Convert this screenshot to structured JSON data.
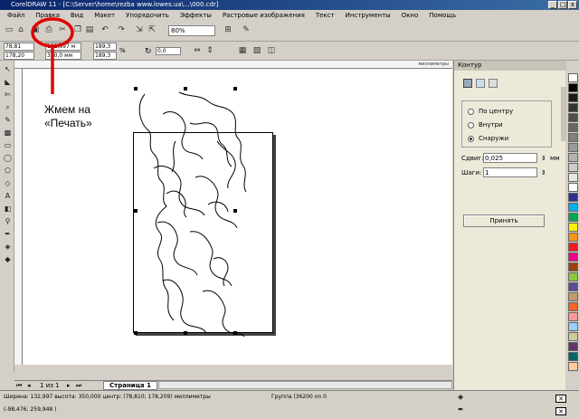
{
  "window": {
    "title": "CorelDRAW 11 - [C:\\Server\\home\\rezba www.lowes.ua\\...\\000.cdr]",
    "controls": [
      "_",
      "□",
      "x"
    ]
  },
  "menu": {
    "items": [
      "Файл",
      "Правка",
      "Вид",
      "Макет",
      "Упорядочить",
      "Эффекты",
      "Растровые изображения",
      "Текст",
      "Инструменты",
      "Окно",
      "Помощь"
    ]
  },
  "toolbar": {
    "zoom_value": "80%"
  },
  "propbar": {
    "x_value": "78,81",
    "y_value": "178,20",
    "width_value": "132,997 м",
    "height_value": "350,0 мм",
    "scale_w": "189,3",
    "scale_h": "189,3",
    "angle_value": "0,0",
    "lock_sign": "%"
  },
  "ruler": {
    "units_label": "миллиметры"
  },
  "annotation": {
    "text_line1": "Жмем на",
    "text_line2": "«Печать»"
  },
  "docker": {
    "title": "Контур",
    "options": [
      "По центру",
      "Внутри",
      "Снаружи"
    ],
    "selected_option": "Снаружи",
    "offset_label": "Сдвиг:",
    "offset_value": "0,025",
    "offset_unit": "мм",
    "steps_label": "Шаги:",
    "steps_value": "1",
    "apply_button": "Принять"
  },
  "pages": {
    "counter": "1 из 1",
    "tab_label": "Страница 1"
  },
  "status": {
    "line1": "Ширина: 132,997  высота: 350,000  центр: (78,810; 178,209)  миллиметры",
    "group_info": "Группа (36200 on 0",
    "line2": "(-98,476; 259,948 )"
  },
  "palette_colors": [
    "#ffffff",
    "#000000",
    "#1a1a1a",
    "#333333",
    "#4d4d4d",
    "#666666",
    "#808080",
    "#999999",
    "#b3b3b3",
    "#cccccc",
    "#e6e6e6",
    "#ffffff",
    "#2e3192",
    "#00aeef",
    "#00a651",
    "#fff200",
    "#f7941d",
    "#ed1c24",
    "#ec008c",
    "#a0410d",
    "#8dc63f",
    "#5e4a94",
    "#c49a6c",
    "#f26522",
    "#ff9999",
    "#99ccff",
    "#cccc99",
    "#663366",
    "#006666",
    "#ffcc99"
  ],
  "colors": {
    "annotation_red": "#e00000",
    "title_blue": "#0a246a"
  }
}
